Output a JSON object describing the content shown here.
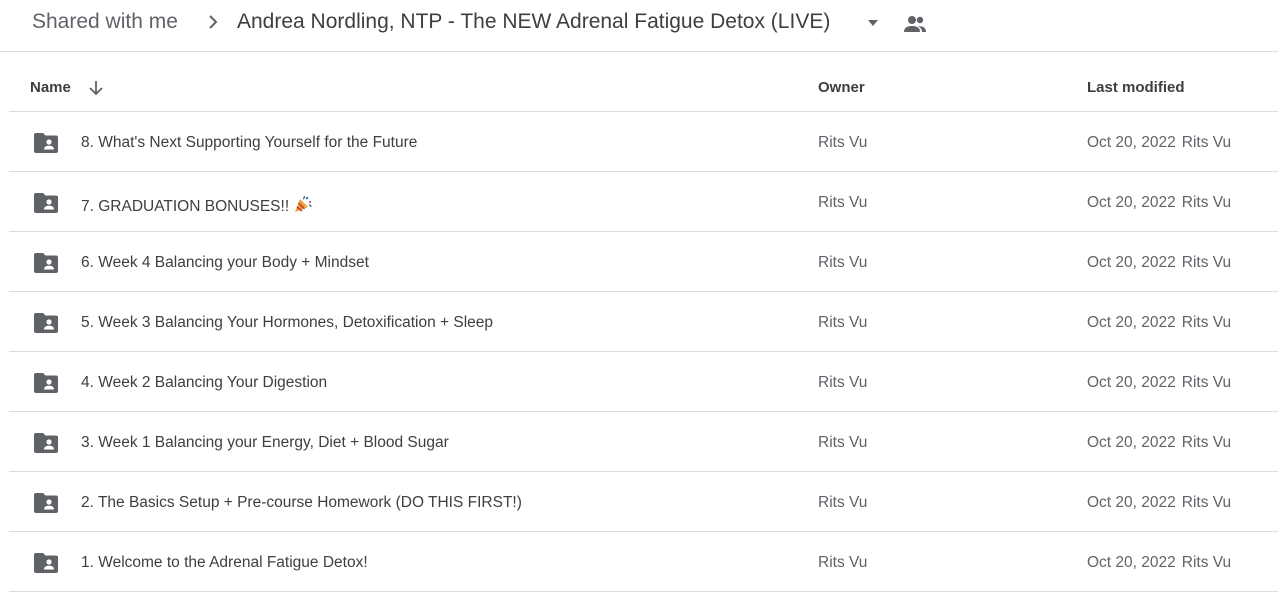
{
  "breadcrumb": {
    "root": "Shared with me",
    "current": "Andrea Nordling, NTP - The NEW Adrenal Fatigue Detox (LIVE)"
  },
  "icons": {
    "separator": "chevron-right-icon",
    "caret": "arrow-drop-down-icon",
    "shared": "people-icon",
    "sort": "arrow-down-icon",
    "folder": "shared-folder-icon",
    "party": "party-popper-icon"
  },
  "header": {
    "name": "Name",
    "owner": "Owner",
    "last_modified": "Last modified"
  },
  "rows": [
    {
      "name": "8. What's Next Supporting Yourself for the Future",
      "owner": "Rits Vu",
      "modified": "Oct 20, 2022",
      "modified_by": "Rits Vu"
    },
    {
      "name": "7. GRADUATION BONUSES!!",
      "owner": "Rits Vu",
      "modified": "Oct 20, 2022",
      "modified_by": "Rits Vu"
    },
    {
      "name": "6. Week 4 Balancing your Body + Mindset",
      "owner": "Rits Vu",
      "modified": "Oct 20, 2022",
      "modified_by": "Rits Vu"
    },
    {
      "name": "5. Week 3 Balancing Your Hormones, Detoxification + Sleep",
      "owner": "Rits Vu",
      "modified": "Oct 20, 2022",
      "modified_by": "Rits Vu"
    },
    {
      "name": "4. Week 2 Balancing Your Digestion",
      "owner": "Rits Vu",
      "modified": "Oct 20, 2022",
      "modified_by": "Rits Vu"
    },
    {
      "name": "3. Week 1 Balancing your Energy, Diet + Blood Sugar",
      "owner": "Rits Vu",
      "modified": "Oct 20, 2022",
      "modified_by": "Rits Vu"
    },
    {
      "name": "2. The Basics Setup + Pre-course Homework (DO THIS FIRST!)",
      "owner": "Rits Vu",
      "modified": "Oct 20, 2022",
      "modified_by": "Rits Vu"
    },
    {
      "name": "1. Welcome to the Adrenal Fatigue Detox!",
      "owner": "Rits Vu",
      "modified": "Oct 20, 2022",
      "modified_by": "Rits Vu"
    }
  ],
  "colors": {
    "text_primary": "#3c4043",
    "text_secondary": "#5f6368",
    "divider": "#dadce0"
  }
}
